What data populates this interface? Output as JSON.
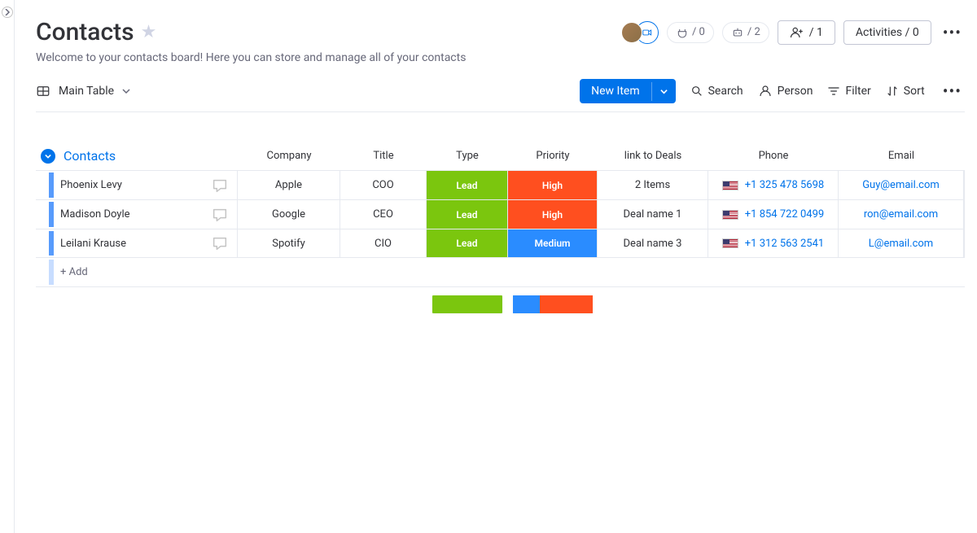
{
  "header": {
    "title": "Contacts",
    "subtitle": "Welcome to your contacts board! Here you can store and manage all of your contacts",
    "integration_count": "/ 0",
    "automation_count": "/ 2",
    "invite_count": "/ 1",
    "activities_label": "Activities / 0"
  },
  "toolbar": {
    "view_label": "Main Table",
    "new_item": "New Item",
    "search": "Search",
    "person": "Person",
    "filter": "Filter",
    "sort": "Sort"
  },
  "group": {
    "title": "Contacts",
    "columns": {
      "company": "Company",
      "title": "Title",
      "type": "Type",
      "priority": "Priority",
      "deals": "link to Deals",
      "phone": "Phone",
      "email": "Email"
    },
    "add_label": "+ Add"
  },
  "rows": [
    {
      "name": "Phoenix Levy",
      "company": "Apple",
      "title": "COO",
      "type": "Lead",
      "priority": "High",
      "priority_class": "prio-high",
      "deals": "2 Items",
      "phone": "+1 325 478 5698",
      "email": "Guy@email.com"
    },
    {
      "name": "Madison Doyle",
      "company": "Google",
      "title": "CEO",
      "type": "Lead",
      "priority": "High",
      "priority_class": "prio-high",
      "deals": "Deal name 1",
      "phone": "+1 854 722 0499",
      "email": "ron@email.com"
    },
    {
      "name": "Leilani Krause",
      "company": "Spotify",
      "title": "CIO",
      "type": "Lead",
      "priority": "Medium",
      "priority_class": "prio-med",
      "deals": "Deal name 3",
      "phone": "+1 312 563 2541",
      "email": "L@email.com"
    }
  ]
}
